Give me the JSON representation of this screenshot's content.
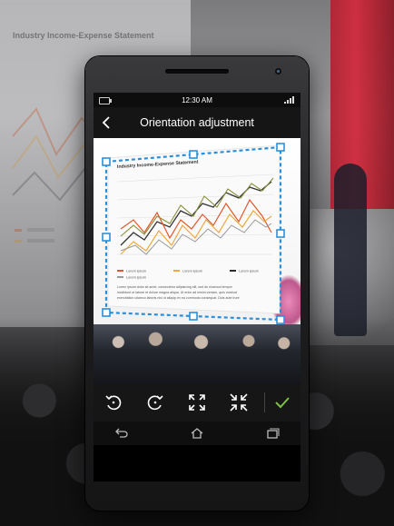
{
  "background": {
    "slide_title": "Industry Income-Expense Statement"
  },
  "status_bar": {
    "time": "12:30 AM"
  },
  "app_bar": {
    "title": "Orientation adjustment",
    "back_icon": "chevron-left-icon"
  },
  "document": {
    "title": "Industry Income-Expense Statement",
    "legend": [
      {
        "label": "Lorem ipsum",
        "color": "#e2572b"
      },
      {
        "label": "Lorem ipsum",
        "color": "#f0a93a"
      },
      {
        "label": "Lorem ipsum",
        "color": "#2b2b2b"
      },
      {
        "label": "Lorem ipsum",
        "color": "#9a9a9a"
      }
    ],
    "caption": [
      "Lorem ipsum dolor sit amet, consectetur adipisicing elit, sed do eiusmod tempor",
      "incididunt ut labore et dolore magna aliqua. Ut enim ad minim veniam, quis nostrud",
      "exercitation ullamco laboris nisi ut aliquip ex ea commodo consequat. Duis aute irure"
    ]
  },
  "crop_frame": {
    "color": "#2d8fd8"
  },
  "toolbar": {
    "tools": [
      "rotate-left-icon",
      "rotate-right-icon",
      "expand-icon",
      "collapse-icon",
      "confirm-check-icon"
    ],
    "accent": "#7bc043"
  },
  "nav_bar": {
    "buttons": [
      "back-nav-icon",
      "home-nav-icon",
      "recent-apps-icon"
    ]
  }
}
